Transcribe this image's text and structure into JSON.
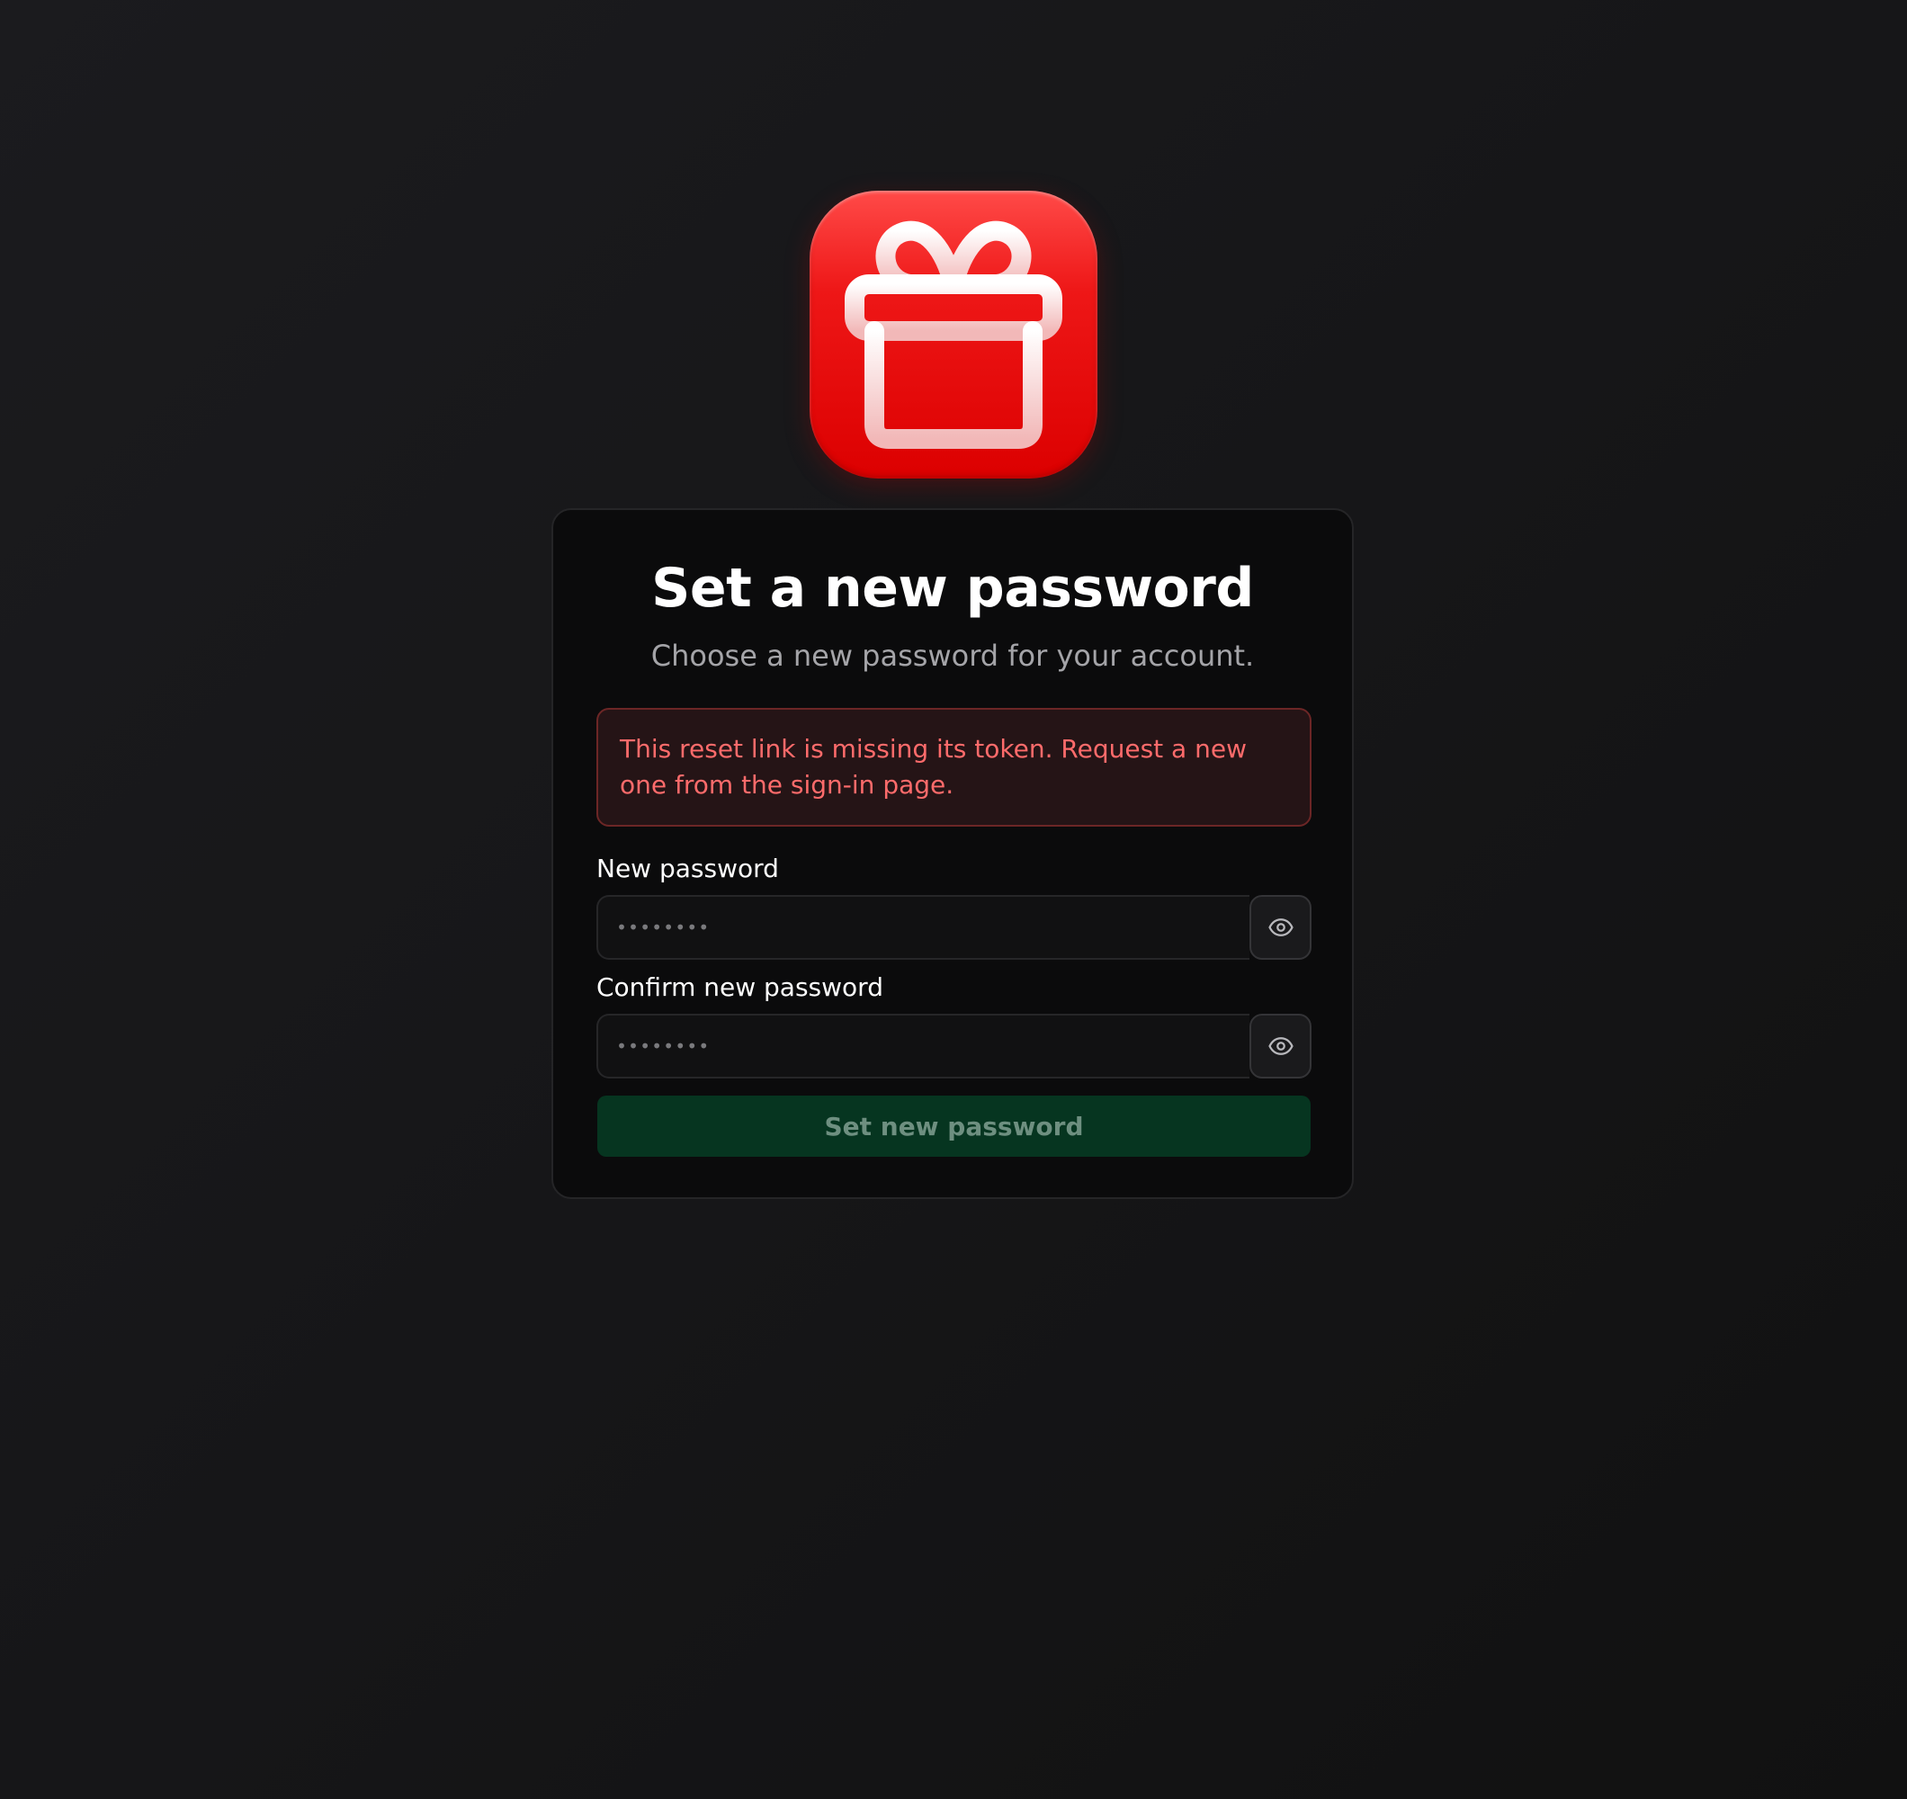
{
  "app": {
    "icon": "gift-icon",
    "brand_color": "#e60c0c"
  },
  "card": {
    "title": "Set a new password",
    "subtitle": "Choose a new password for your account."
  },
  "alert": {
    "message": "This reset link is missing its token. Request a new one from the sign-in page.",
    "color": "#ff6b6b"
  },
  "form": {
    "new_password": {
      "label": "New password",
      "placeholder": "••••••••",
      "value": "",
      "toggle_icon": "eye-icon"
    },
    "confirm_password": {
      "label": "Confirm new password",
      "placeholder": "••••••••",
      "value": "",
      "toggle_icon": "eye-icon"
    },
    "submit": {
      "label": "Set new password",
      "disabled": true,
      "color": "#063520"
    }
  }
}
